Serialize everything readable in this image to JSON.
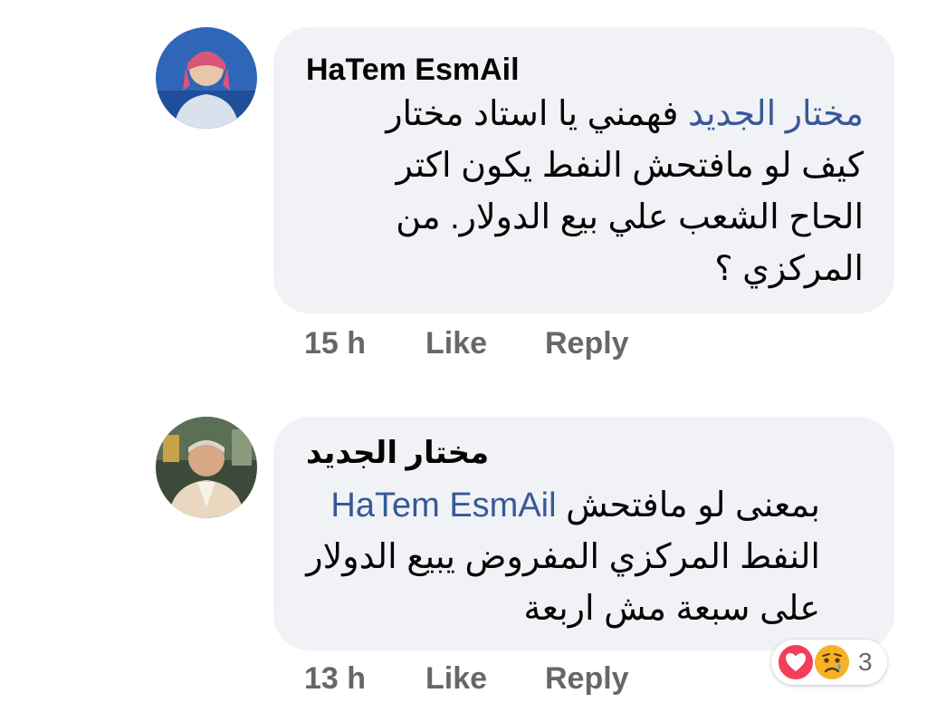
{
  "comments": [
    {
      "author": "HaTem EsmAil",
      "mention": "مختار الجديد",
      "line1_rest": " فهمني يا استاد مختار",
      "line2": "كيف لو مافتحش النفط يكون اكتر",
      "line3": "الحاح الشعب علي بيع الدولار. من",
      "line4": "المركزي ؟",
      "time": "15 h",
      "like_label": "Like",
      "reply_label": "Reply"
    },
    {
      "author": "مختار الجديد",
      "line1_start": "بمعنى لو مافتحش ",
      "mention": "HaTem EsmAil",
      "line2": "النفط المركزي المفروض يبيع الدولار",
      "line3": "على سبعة مش اربعة",
      "time": "13 h",
      "like_label": "Like",
      "reply_label": "Reply",
      "reaction_count": "3",
      "reaction_icons": [
        "heart-icon",
        "sad-face-icon"
      ]
    }
  ],
  "colors": {
    "bubble": "#f0f2f5",
    "mention": "#385898",
    "meta": "#65676b",
    "heart": "#f33e58",
    "sad": "#f7b125"
  }
}
